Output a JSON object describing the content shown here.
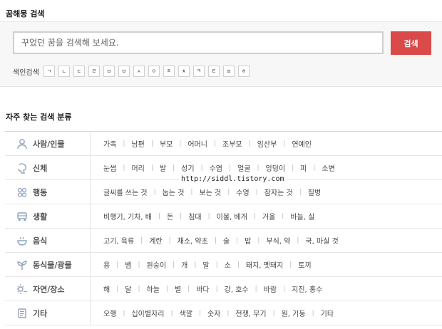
{
  "search_section": {
    "title": "꿈해몽 검색",
    "placeholder": "꾸었던 꿈을 검색해 보세요.",
    "button_label": "검색",
    "index_label": "색인검색",
    "index_letters": [
      "ㄱ",
      "ㄴ",
      "ㄷ",
      "ㄹ",
      "ㅁ",
      "ㅂ",
      "ㅅ",
      "ㅇ",
      "ㅈ",
      "ㅊ",
      "ㅋ",
      "ㅌ",
      "ㅍ",
      "ㅎ"
    ]
  },
  "category_section": {
    "title": "자주 찾는 검색 분류",
    "categories": [
      {
        "name": "사람/인물",
        "icon": "person-icon",
        "items": [
          "가족",
          "남편",
          "부모",
          "어머니",
          "조부모",
          "임산부",
          "연예인"
        ]
      },
      {
        "name": "신체",
        "icon": "body-icon",
        "items": [
          "눈썹",
          "머리",
          "발",
          "성기",
          "수염",
          "얼굴",
          "엉덩이",
          "피",
          "소변"
        ]
      },
      {
        "name": "행동",
        "icon": "people-icon",
        "items": [
          "글씨를 쓰는 것",
          "눕는 것",
          "보는 것",
          "수영",
          "잠자는 것",
          "질병"
        ]
      },
      {
        "name": "생활",
        "icon": "car-icon",
        "items": [
          "비행기, 기차, 배",
          "돈",
          "침대",
          "이불, 베개",
          "거울",
          "바늘, 실"
        ]
      },
      {
        "name": "음식",
        "icon": "food-icon",
        "items": [
          "고기, 육류",
          "계란",
          "채소, 약초",
          "술",
          "밥",
          "부식, 약",
          "국, 마실 것"
        ]
      },
      {
        "name": "동식물/광물",
        "icon": "plant-icon",
        "items": [
          "용",
          "뱀",
          "원숭이",
          "개",
          "말",
          "소",
          "돼지, 멧돼지",
          "토끼"
        ]
      },
      {
        "name": "자연/장소",
        "icon": "nature-icon",
        "items": [
          "해",
          "달",
          "하늘",
          "별",
          "바다",
          "강, 호수",
          "바람",
          "지진, 홍수"
        ]
      },
      {
        "name": "기타",
        "icon": "misc-icon",
        "items": [
          "오행",
          "십이별자리",
          "색깔",
          "숫자",
          "전쟁, 무기",
          "원, 기둥",
          "기타"
        ]
      }
    ]
  },
  "watermark": "http://siddl.tistory.com",
  "colors": {
    "accent": "#d94a48",
    "icon": "#8fa3bd"
  }
}
